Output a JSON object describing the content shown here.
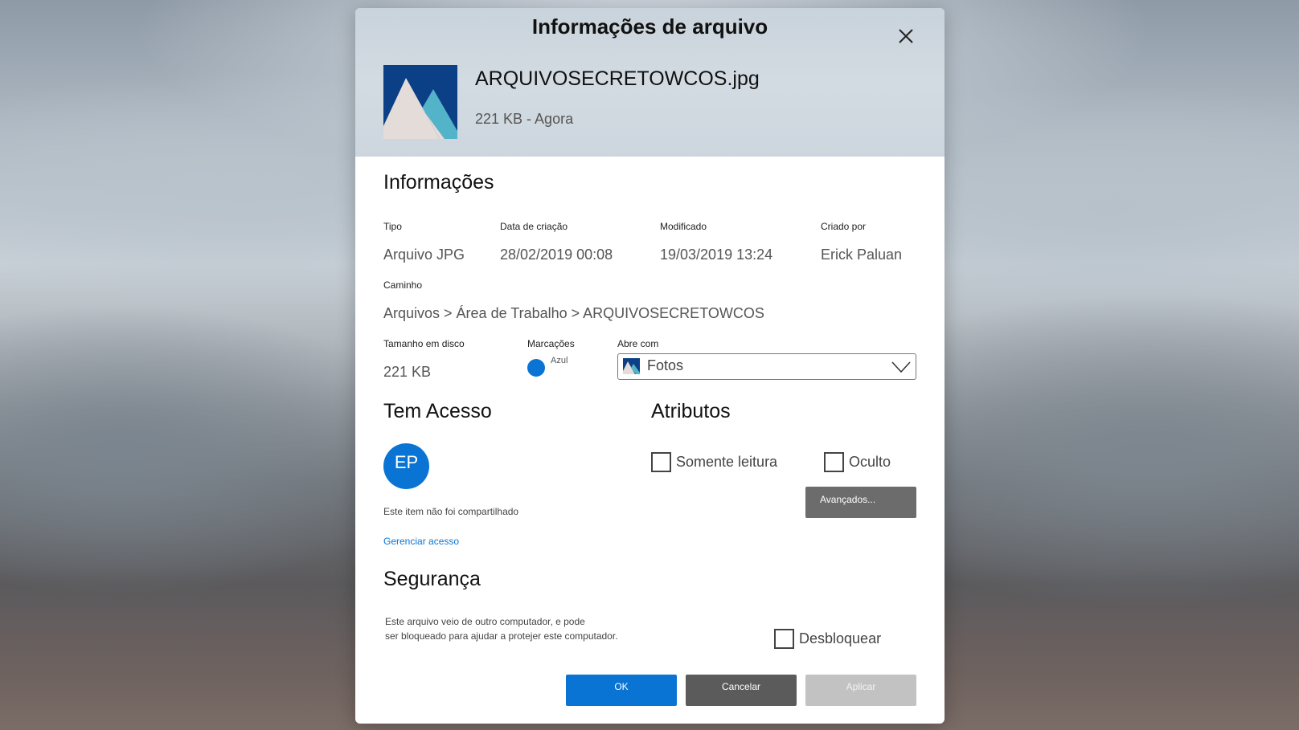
{
  "dialog": {
    "title": "Informações de arquivo",
    "file_name": "ARQUIVOSECRETOWCOS.jpg",
    "file_meta": "221 KB - Agora"
  },
  "info": {
    "heading": "Informações",
    "type_label": "Tipo",
    "type_value": "Arquivo JPG",
    "created_label": "Data de criação",
    "created_value": "28/02/2019 00:08",
    "modified_label": "Modificado",
    "modified_value": "19/03/2019 13:24",
    "author_label": "Criado por",
    "author_value": "Erick Paluan",
    "path_label": "Caminho",
    "path_value": "Arquivos > Área de Trabalho > ARQUIVOSECRETOWCOS",
    "size_label": "Tamanho em disco",
    "size_value": "221 KB",
    "tags_label": "Marcações",
    "tag_name": "Azul",
    "tag_color": "#0a74d4",
    "opens_with_label": "Abre com",
    "opens_with_value": "Fotos"
  },
  "access": {
    "heading": "Tem Acesso",
    "avatar_initials": "EP",
    "share_status": "Este item não foi compartilhado",
    "manage_link": "Gerenciar acesso"
  },
  "attributes": {
    "heading": "Atributos",
    "readonly_label": "Somente leitura",
    "hidden_label": "Oculto",
    "advanced_label": "Avançados..."
  },
  "security": {
    "heading": "Segurança",
    "line1": "Este arquivo veio de outro computador, e pode",
    "line2": "ser bloqueado para ajudar a protejer este computador.",
    "unblock_label": "Desbloquear"
  },
  "buttons": {
    "ok": "OK",
    "cancel": "Cancelar",
    "apply": "Aplicar"
  },
  "colors": {
    "accent": "#0a74d4"
  }
}
